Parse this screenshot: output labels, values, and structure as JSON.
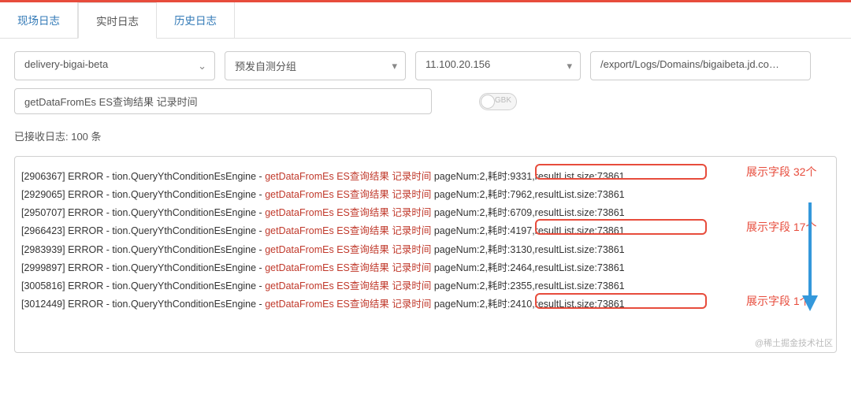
{
  "tabs": {
    "t0": "现场日志",
    "t1": "实时日志",
    "t2": "历史日志"
  },
  "filters": {
    "app": "delivery-bigai-beta",
    "group": "预发自测分组",
    "ip": "11.100.20.156",
    "path": "/export/Logs/Domains/bigaibeta.jd.com/serve"
  },
  "search": {
    "value": "getDataFromEs ES查询结果 记录时间"
  },
  "toggle": {
    "label": "GBK"
  },
  "status": "已接收日志: 100 条",
  "log_prefix_engine": " ERROR - tion.QueryYthConditionEsEngine - ",
  "log_red": "getDataFromEs ES查询结果 记录时间",
  "logs": [
    {
      "id": "[2906367]",
      "tail": " pageNum:2,耗时:9331,resultList.size:73861"
    },
    {
      "id": "[2929065]",
      "tail": " pageNum:2,耗时:7962,resultList.size:73861"
    },
    {
      "id": "[2950707]",
      "tail": " pageNum:2,耗时:6709,resultList.size:73861"
    },
    {
      "id": "[2966423]",
      "tail": " pageNum:2,耗时:4197,resultList.size:73861"
    },
    {
      "id": "[2983939]",
      "tail": " pageNum:2,耗时:3130,resultList.size:73861"
    },
    {
      "id": "[2999897]",
      "tail": " pageNum:2,耗时:2464,resultList.size:73861"
    },
    {
      "id": "[3005816]",
      "tail": " pageNum:2,耗时:2355,resultList.size:73861"
    },
    {
      "id": "[3012449]",
      "tail": " pageNum:2,耗时:2410,resultList.size:73861"
    }
  ],
  "annotations": {
    "a1": "展示字段 32个",
    "a2": "展示字段 17个",
    "a3": "展示字段 1个"
  },
  "watermark": "@稀土掘金技术社区"
}
